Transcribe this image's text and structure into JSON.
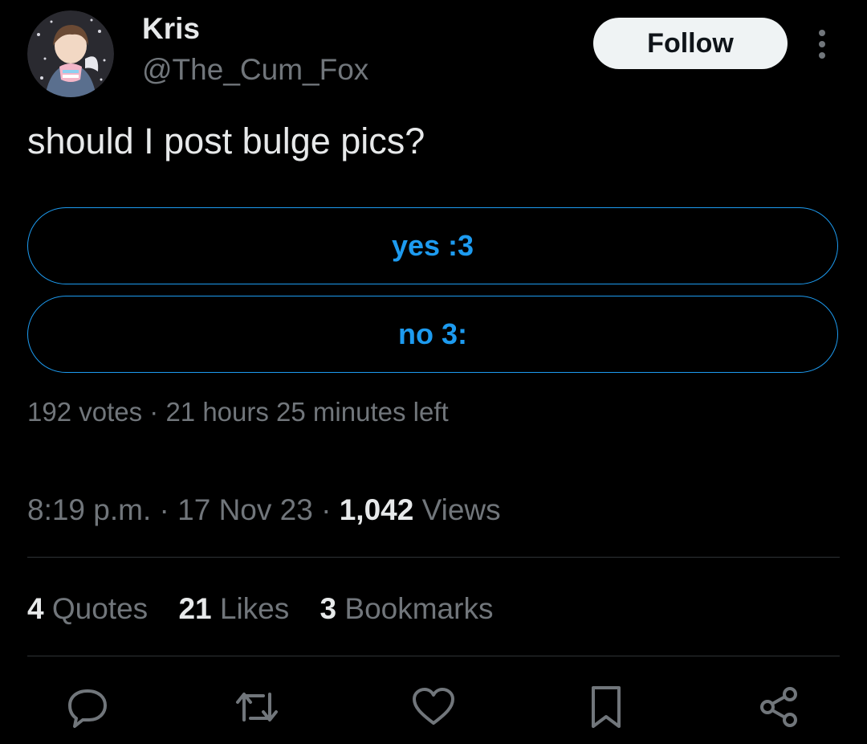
{
  "author": {
    "name": "Kris",
    "handle": "@The_Cum_Fox"
  },
  "follow_label": "Follow",
  "tweet": {
    "text": "should I post bulge pics?"
  },
  "poll": {
    "options": [
      {
        "label": "yes :3"
      },
      {
        "label": "no 3:"
      }
    ],
    "votes": "192 votes",
    "separator": "·",
    "time_left": "21 hours 25 minutes left"
  },
  "meta": {
    "time": "8:19 p.m.",
    "date": "17 Nov 23",
    "views_count": "1,042",
    "views_label": "Views",
    "dot": "·"
  },
  "stats": {
    "quotes_count": "4",
    "quotes_label": "Quotes",
    "likes_count": "21",
    "likes_label": "Likes",
    "bookmarks_count": "3",
    "bookmarks_label": "Bookmarks"
  },
  "actions": [
    "reply-icon",
    "retweet-icon",
    "like-icon",
    "bookmark-icon",
    "share-icon"
  ],
  "colors": {
    "accent": "#1d9bf0",
    "background": "#000000",
    "muted": "#71767b",
    "text": "#e7e9ea"
  }
}
